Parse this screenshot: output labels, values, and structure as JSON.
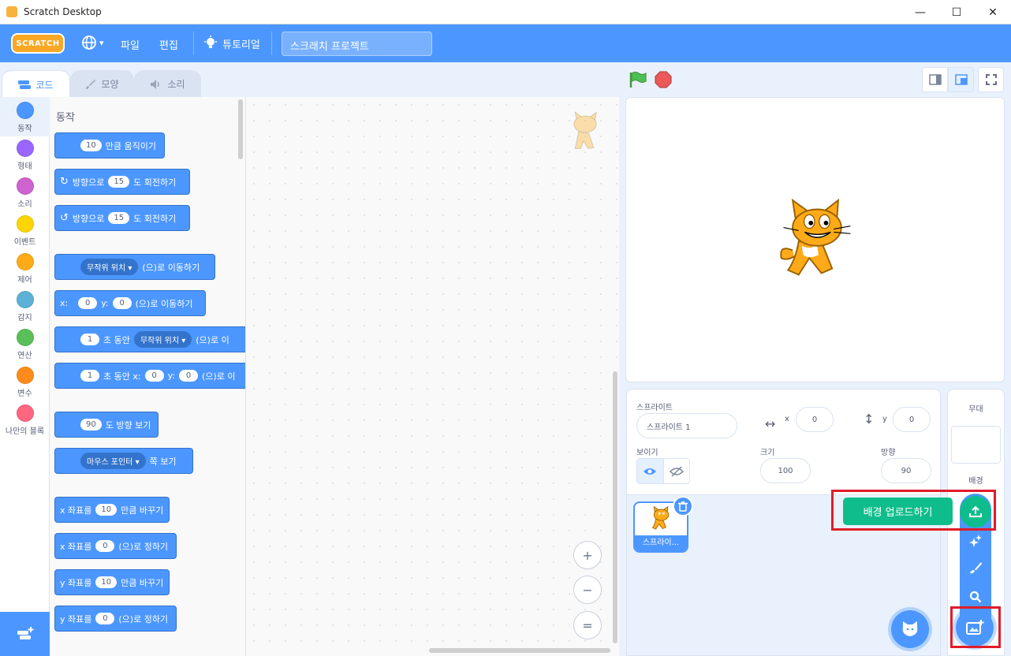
{
  "window": {
    "title": "Scratch Desktop",
    "minimize": "—",
    "maximize": "☐",
    "close": "✕"
  },
  "menu": {
    "logo": "SCRATCH",
    "language_caret": "▾",
    "file": "파일",
    "edit": "편집",
    "tutorials": "튜토리얼",
    "project_title": "스크래치 프로젝트"
  },
  "tabs": {
    "code": "코드",
    "costumes": "모양",
    "sounds": "소리"
  },
  "categories": [
    {
      "label": "동작",
      "color": "#4c97ff"
    },
    {
      "label": "형태",
      "color": "#9966ff"
    },
    {
      "label": "소리",
      "color": "#cf63cf"
    },
    {
      "label": "이벤트",
      "color": "#ffd500"
    },
    {
      "label": "제어",
      "color": "#ffab19"
    },
    {
      "label": "감지",
      "color": "#5cb1d6"
    },
    {
      "label": "연산",
      "color": "#59c059"
    },
    {
      "label": "변수",
      "color": "#ff8c1a"
    },
    {
      "label": "나만의 블록",
      "color": "#ff6680"
    }
  ],
  "palette": {
    "heading": "동작",
    "blocks": {
      "move": {
        "value": "10",
        "text": "만큼 움직이기"
      },
      "turn_right": {
        "prefix": "방향으로",
        "value": "15",
        "text": "도 회전하기"
      },
      "turn_left": {
        "prefix": "방향으로",
        "value": "15",
        "text": "도 회전하기"
      },
      "goto": {
        "dropdown": "무작위 위치",
        "text": "(으)로 이동하기"
      },
      "goto_xy": {
        "x_label": "x:",
        "x": "0",
        "y_label": "y:",
        "y": "0",
        "text": "(으)로 이동하기"
      },
      "glide": {
        "value": "1",
        "mid": "초 동안",
        "dropdown": "무작위 위치",
        "text": "(으)로 이"
      },
      "glide_xy": {
        "value": "1",
        "mid": "초 동안 x:",
        "x": "0",
        "y_label": "y:",
        "y": "0",
        "text": "(으)로 이"
      },
      "point_dir": {
        "value": "90",
        "text": "도 방향 보기"
      },
      "point_towards": {
        "dropdown": "마우스 포인터",
        "text": "쪽 보기"
      },
      "change_x": {
        "prefix": "x 좌표를",
        "value": "10",
        "text": "만큼 바꾸기"
      },
      "set_x": {
        "prefix": "x 좌표를",
        "value": "0",
        "text": "(으)로 정하기"
      },
      "change_y": {
        "prefix": "y 좌표를",
        "value": "10",
        "text": "만큼 바꾸기"
      },
      "set_y": {
        "prefix": "y 좌표를",
        "value": "0",
        "text": "(으)로 정하기"
      }
    }
  },
  "zoom": {
    "in": "+",
    "out": "−",
    "reset": "="
  },
  "sprite_info": {
    "sprite_label": "스프라이트",
    "sprite_name": "스프라이트 1",
    "x_label": "x",
    "x": "0",
    "y_label": "y",
    "y": "0",
    "show_label": "보이기",
    "size_label": "크기",
    "size": "100",
    "direction_label": "방향",
    "direction": "90"
  },
  "sprite_list": {
    "thumb_name": "스프라이..."
  },
  "stage_panel": {
    "title": "무대",
    "backdrops_label": "배경"
  },
  "tooltip": {
    "upload_backdrop": "배경 업로드하기"
  },
  "colors": {
    "accent": "#4c97ff",
    "highlight": "#e01c2a",
    "tooltip": "#0fbd8c"
  }
}
